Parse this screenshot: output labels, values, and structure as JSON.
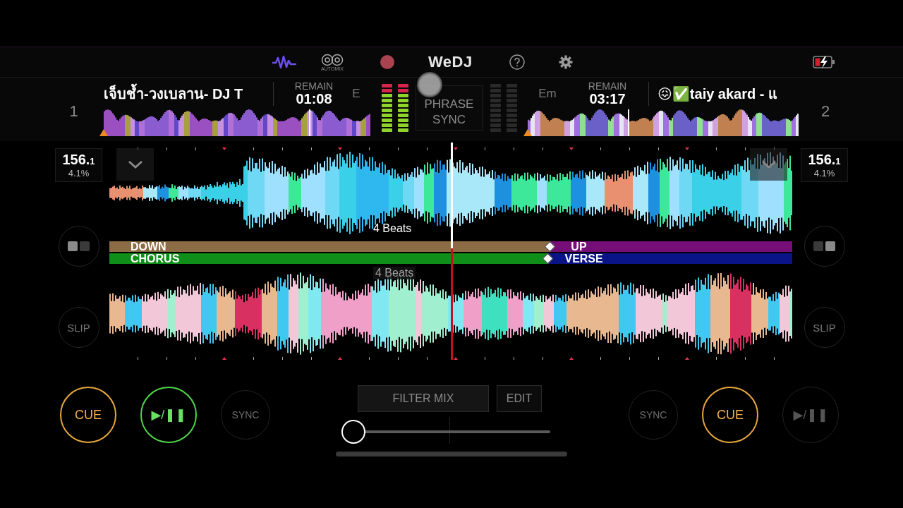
{
  "header": {
    "automix_label": "AUTOMIX",
    "logo": "WeDJ"
  },
  "decks": [
    {
      "number": "1",
      "title": "เจ็บช้ำ-วงเบลาน- DJ T",
      "remain_label": "REMAIN",
      "remain": "01:08",
      "key": "E",
      "position": {
        "level": 0.77
      },
      "bpm": "156.$_{1}$",
      "pitch": "4.1%",
      "toggle": [
        {
          "selected": true
        },
        {
          "selected": false
        }
      ],
      "slip": "SLIP",
      "beat_label": {
        "text": "4 Beats",
        "faded": false
      },
      "cue": "CUE",
      "play": "▶/❚❚",
      "playing": true,
      "sync": "SYNC"
    },
    {
      "number": "2",
      "title": "😖✅taiy akard - แ",
      "remain_label": "REMAIN",
      "remain": "03:17",
      "key": "Em",
      "position": {
        "level": 0.37
      },
      "bpm": "156.$_{1}$",
      "pitch": "4.1%",
      "toggle": [
        {
          "selected": false
        },
        {
          "selected": true
        }
      ],
      "slip": "SLIP",
      "beat_label": {
        "text": "4 Beats",
        "faded": true
      },
      "cue": "CUE",
      "play": "▶/❚❚",
      "playing": false,
      "sync": "SYNC"
    }
  ],
  "phrase_sync": "PHRASE SYNC",
  "phrases": [
    {
      "level": 0.645,
      "segments": [
        {
          "label": "DOWN",
          "color": "#8c6c45"
        },
        {
          "label": "UP",
          "color": "#760e78"
        }
      ]
    },
    {
      "level": 0.642,
      "segments": [
        {
          "label": "CHORUS",
          "color": "#0f8e19"
        },
        {
          "label": "VERSE",
          "color": "#0a1486"
        }
      ]
    }
  ],
  "mixer": {
    "filter_label": "FILTER MIX",
    "edit": "EDIT",
    "crossfader": {
      "level": 0
    }
  }
}
